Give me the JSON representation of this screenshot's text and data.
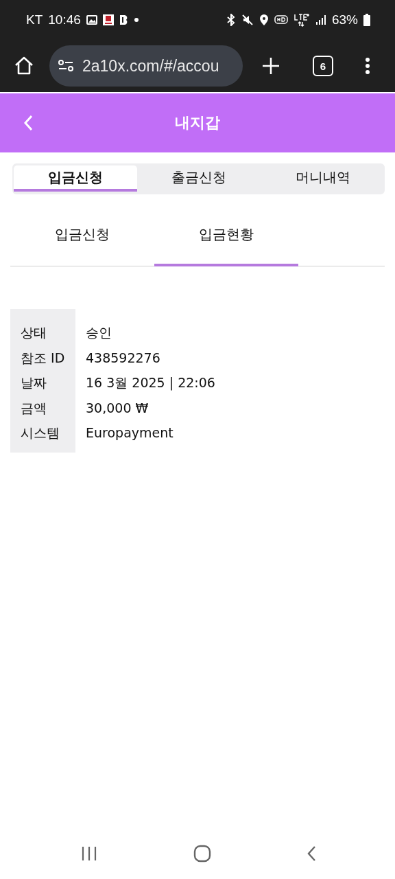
{
  "status_bar": {
    "carrier": "KT",
    "time": "10:46",
    "battery": "63%"
  },
  "browser": {
    "url": "2a10x.com/#/accou",
    "tab_count": "6"
  },
  "header": {
    "title": "내지갑"
  },
  "tabs": [
    {
      "label": "입금신청",
      "selected": true
    },
    {
      "label": "출금신청",
      "selected": false
    },
    {
      "label": "머니내역",
      "selected": false
    }
  ],
  "subtabs": [
    {
      "label": "입금신청",
      "selected": false
    },
    {
      "label": "입금현황",
      "selected": true
    }
  ],
  "details": [
    {
      "label": "상태",
      "value": "승인"
    },
    {
      "label": "참조 ID",
      "value": "438592276"
    },
    {
      "label": "날짜",
      "value": "16 3월 2025 | 22:06"
    },
    {
      "label": "금액",
      "value": "30,000 ₩"
    },
    {
      "label": "시스템",
      "value": "Europayment"
    }
  ]
}
